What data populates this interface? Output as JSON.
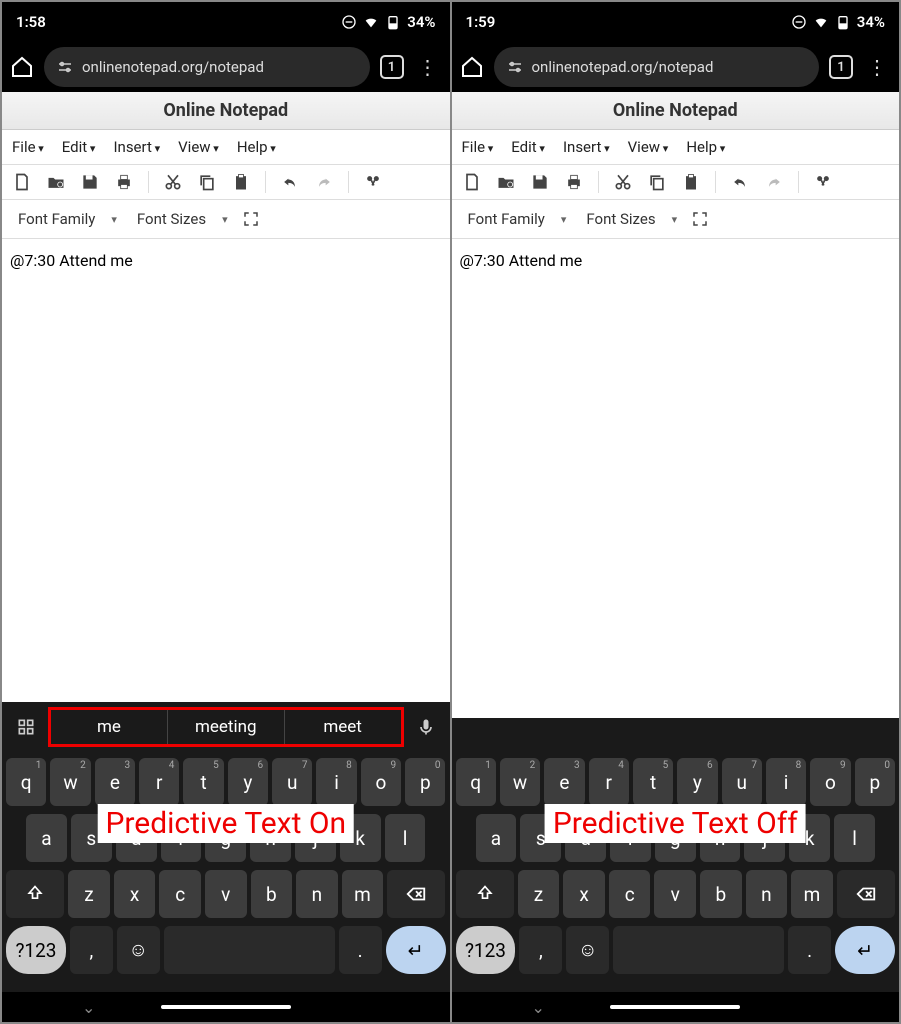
{
  "left": {
    "status": {
      "time": "1:58",
      "battery": "34%"
    },
    "browser": {
      "url": "onlinenotepad.org/notepad",
      "tabs": "1"
    },
    "app_title": "Online Notepad",
    "menus": [
      "File",
      "Edit",
      "Insert",
      "View",
      "Help"
    ],
    "toolbar2": {
      "font_family": "Font Family",
      "font_sizes": "Font Sizes"
    },
    "editor_text": "@7:30 Attend me",
    "suggestions": [
      "me",
      "meeting",
      "meet"
    ],
    "annotation": "Predictive Text On",
    "show_suggestions": true
  },
  "right": {
    "status": {
      "time": "1:59",
      "battery": "34%"
    },
    "browser": {
      "url": "onlinenotepad.org/notepad",
      "tabs": "1"
    },
    "app_title": "Online Notepad",
    "menus": [
      "File",
      "Edit",
      "Insert",
      "View",
      "Help"
    ],
    "toolbar2": {
      "font_family": "Font Family",
      "font_sizes": "Font Sizes"
    },
    "editor_text": "@7:30 Attend me",
    "annotation": "Predictive Text Off",
    "show_suggestions": false
  },
  "keyboard": {
    "row1": [
      {
        "k": "q",
        "n": "1"
      },
      {
        "k": "w",
        "n": "2"
      },
      {
        "k": "e",
        "n": "3"
      },
      {
        "k": "r",
        "n": "4"
      },
      {
        "k": "t",
        "n": "5"
      },
      {
        "k": "y",
        "n": "6"
      },
      {
        "k": "u",
        "n": "7"
      },
      {
        "k": "i",
        "n": "8"
      },
      {
        "k": "o",
        "n": "9"
      },
      {
        "k": "p",
        "n": "0"
      }
    ],
    "row2": [
      "a",
      "s",
      "d",
      "f",
      "g",
      "h",
      "j",
      "k",
      "l"
    ],
    "row3": [
      "z",
      "x",
      "c",
      "v",
      "b",
      "n",
      "m"
    ],
    "numkey": "?123"
  }
}
